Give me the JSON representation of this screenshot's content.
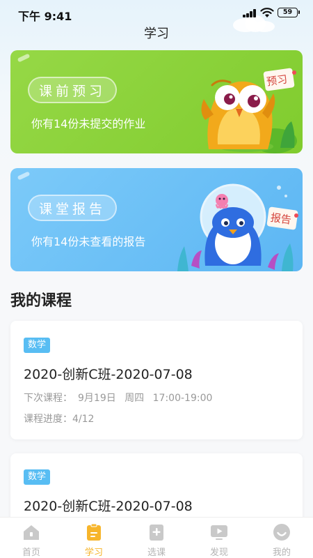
{
  "status_bar": {
    "time": "下午 9:41",
    "battery": "59"
  },
  "header": {
    "title": "学习"
  },
  "cards": [
    {
      "title": "课前预习",
      "subtitle": "你有14份未提交的作业",
      "badge": "预习",
      "color": "#8ad33b"
    },
    {
      "title": "课堂报告",
      "subtitle": "你有14份未查看的报告",
      "badge": "报告",
      "color": "#6cc0f6"
    }
  ],
  "section": {
    "title": "我的课程"
  },
  "courses": [
    {
      "subject": "数学",
      "name": "2020-创新C班-2020-07-08",
      "next_label": "下次课程：",
      "next_date": "9月19日",
      "next_weekday": "周四",
      "next_time": "17:00-19:00",
      "progress_label": "课程进度：",
      "progress": "4/12"
    },
    {
      "subject": "数学",
      "name": "2020-创新C班-2020-07-08"
    }
  ],
  "tabs": [
    {
      "label": "首页",
      "icon": "home-icon",
      "active": false
    },
    {
      "label": "学习",
      "icon": "study-clipboard-icon",
      "active": true
    },
    {
      "label": "选课",
      "icon": "add-course-icon",
      "active": false
    },
    {
      "label": "发现",
      "icon": "discover-play-icon",
      "active": false
    },
    {
      "label": "我的",
      "icon": "profile-icon",
      "active": false
    }
  ],
  "colors": {
    "active_tab": "#f6b428",
    "inactive_tab": "#c4c4c4",
    "tag_blue": "#58bdf3"
  }
}
